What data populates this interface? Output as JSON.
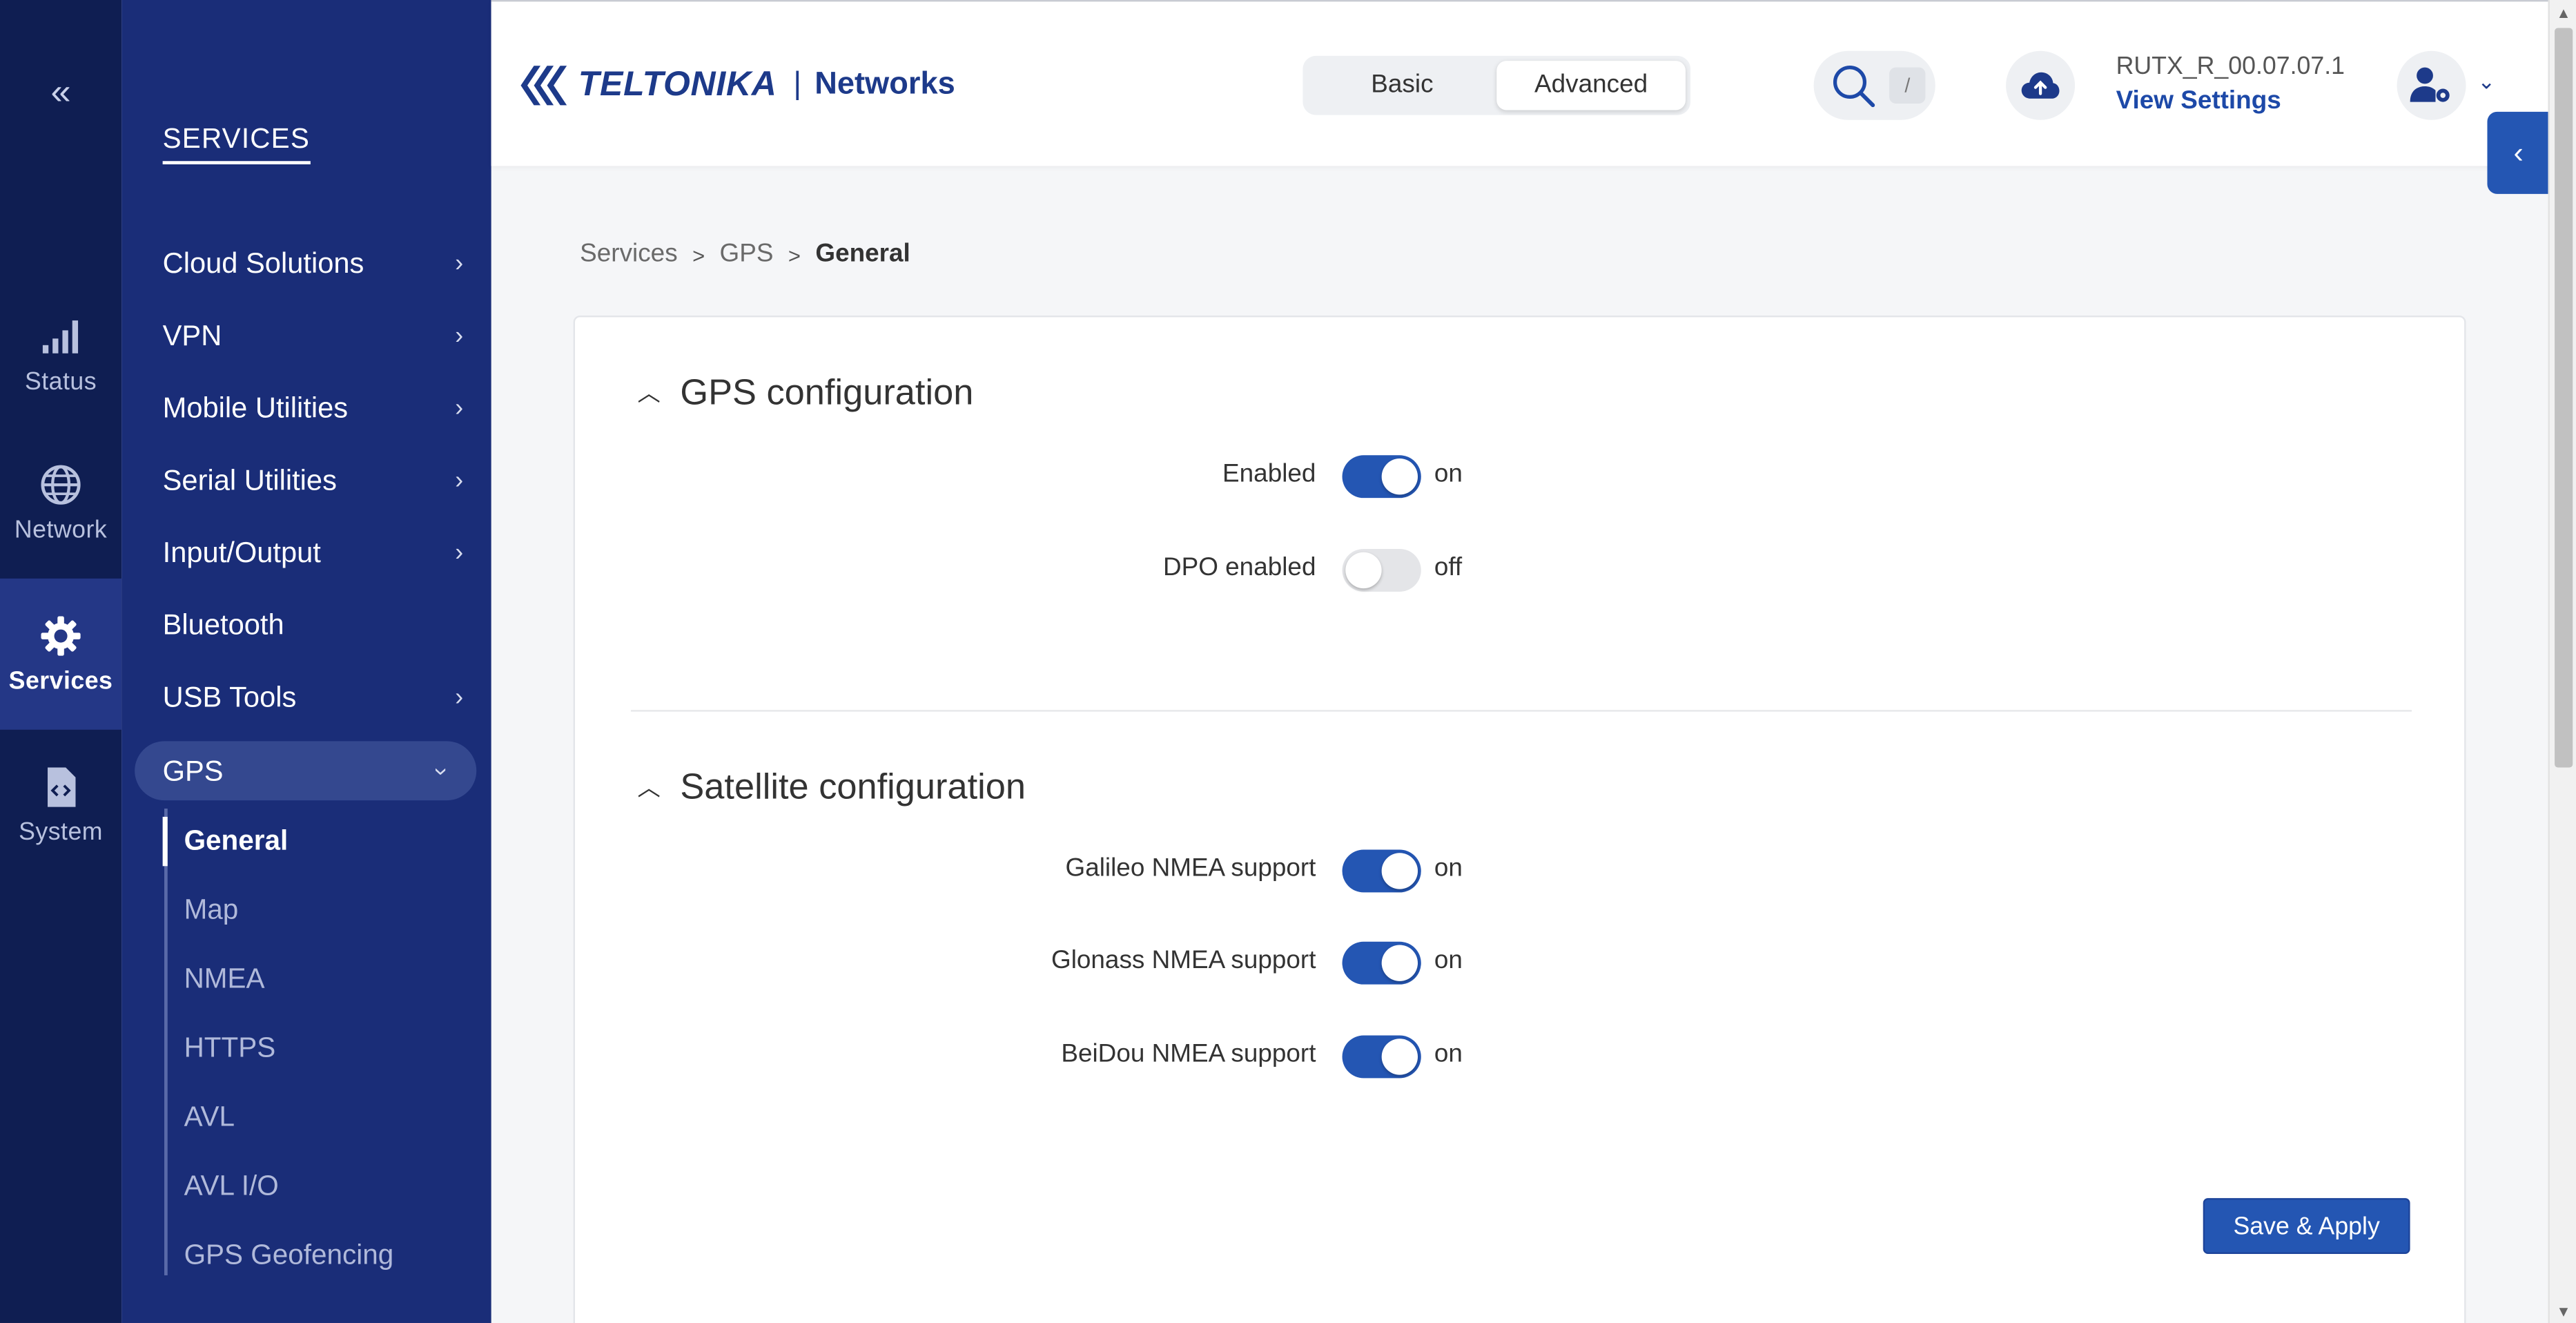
{
  "rail": {
    "collapse_glyph": "«",
    "items": [
      {
        "label": "Status",
        "icon": "signal-bars-icon"
      },
      {
        "label": "Network",
        "icon": "globe-icon"
      },
      {
        "label": "Services",
        "icon": "gear-icon"
      },
      {
        "label": "System",
        "icon": "code-file-icon"
      }
    ]
  },
  "subnav": {
    "section_title": "SERVICES",
    "items": [
      {
        "label": "Cloud Solutions",
        "has_children": true
      },
      {
        "label": "VPN",
        "has_children": true
      },
      {
        "label": "Mobile Utilities",
        "has_children": true
      },
      {
        "label": "Serial Utilities",
        "has_children": true
      },
      {
        "label": "Input/Output",
        "has_children": true
      },
      {
        "label": "Bluetooth",
        "has_children": false
      },
      {
        "label": "USB Tools",
        "has_children": true
      },
      {
        "label": "GPS",
        "has_children": true,
        "expanded": true
      }
    ],
    "gps_children": [
      "General",
      "Map",
      "NMEA",
      "HTTPS",
      "AVL",
      "AVL I/O",
      "GPS Geofencing"
    ],
    "active_child": "General"
  },
  "header": {
    "brand": "TELTONIKA",
    "brand_sep": "|",
    "brand_suffix": "Networks",
    "mode_options": [
      "Basic",
      "Advanced"
    ],
    "mode_selected": "Advanced",
    "search_shortcut": "/",
    "firmware_version": "RUTX_R_00.07.07.1",
    "view_settings_label": "View Settings"
  },
  "breadcrumb": [
    "Services",
    "GPS",
    "General"
  ],
  "sections": {
    "gps": {
      "title": "GPS configuration",
      "rows": [
        {
          "label": "Enabled",
          "value": true,
          "state": "on"
        },
        {
          "label": "DPO enabled",
          "value": false,
          "state": "off"
        }
      ]
    },
    "satellite": {
      "title": "Satellite configuration",
      "rows": [
        {
          "label": "Galileo NMEA support",
          "value": true,
          "state": "on"
        },
        {
          "label": "Glonass NMEA support",
          "value": true,
          "state": "on"
        },
        {
          "label": "BeiDou NMEA support",
          "value": true,
          "state": "on"
        }
      ]
    }
  },
  "actions": {
    "save_label": "Save & Apply"
  },
  "colors": {
    "rail_bg": "#0f1e52",
    "subnav_bg": "#1a2d78",
    "accent": "#2456b3",
    "toggle_off": "#e4e5e8"
  }
}
